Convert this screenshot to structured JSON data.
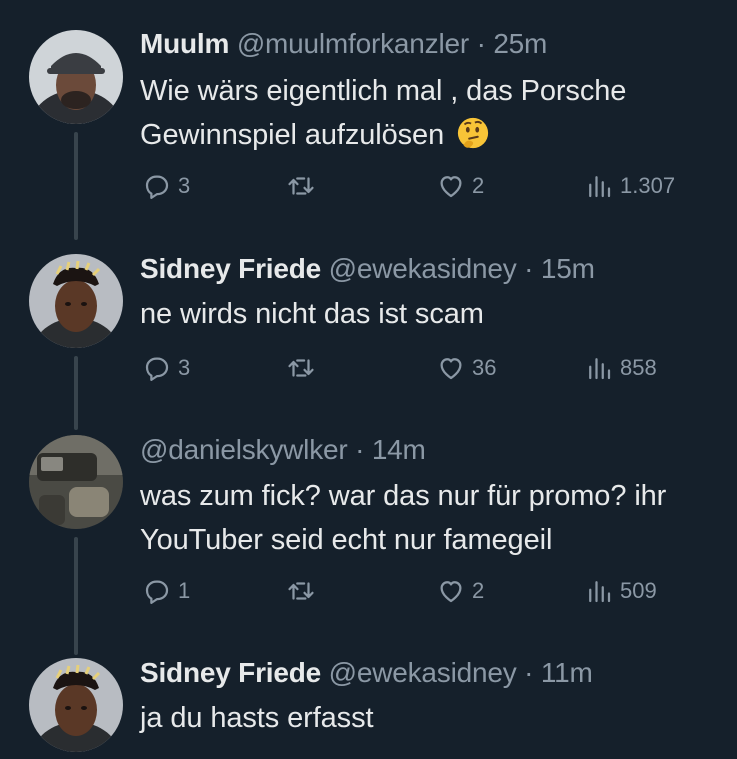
{
  "tweets": [
    {
      "name": "Muulm",
      "handle": "@muulmforkanzler",
      "dot": "·",
      "time": "25m",
      "text_line1": "Wie wärs eigentlich mal , das Porsche",
      "text_line2": "Gewinnspiel aufzulösen",
      "emoji": "thinking-face",
      "replies": "3",
      "retweets": "",
      "likes": "2",
      "views": "1.307"
    },
    {
      "name": "Sidney Friede",
      "handle": "@ewekasidney",
      "dot": "·",
      "time": "15m",
      "text_line1": "ne wirds nicht das ist scam",
      "replies": "3",
      "retweets": "",
      "likes": "36",
      "views": "858"
    },
    {
      "name": "",
      "handle": "@danielskywlker",
      "dot": "·",
      "time": "14m",
      "text_line1": "was zum fick? war das nur für promo? ihr",
      "text_line2": "YouTuber seid echt nur famegeil",
      "replies": "1",
      "retweets": "",
      "likes": "2",
      "views": "509"
    },
    {
      "name": "Sidney Friede",
      "handle": "@ewekasidney",
      "dot": "·",
      "time": "11m",
      "text_line1": "ja du hasts erfasst"
    }
  ],
  "colors": {
    "background": "#15202b",
    "text": "#e7e9ea",
    "secondary": "#8b98a5",
    "thread_line": "#38444d"
  }
}
